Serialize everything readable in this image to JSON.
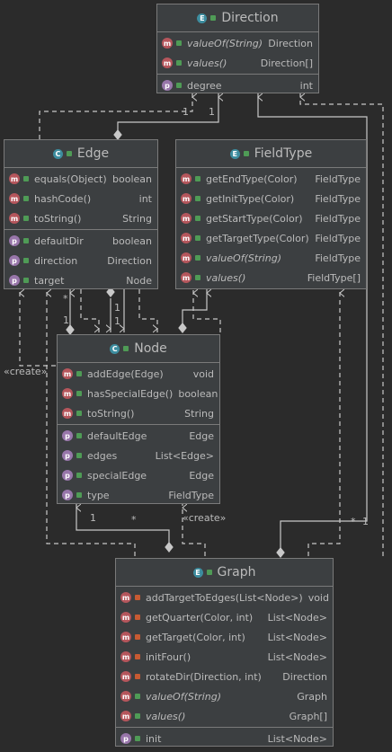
{
  "colors": {
    "background": "#2b2b2b",
    "class_fill": "#3c3f41",
    "class_border": "#7a7a7a",
    "edge_line": "#c8c8c8",
    "enum_badge": "#3d8d9f",
    "class_badge": "#3d8d9f",
    "method_icon": "#b5565c",
    "property_icon": "#9876aa",
    "public_marker": "#4f9b56",
    "private_marker": "#c75a32"
  },
  "classes": {
    "direction": {
      "kind": "E",
      "name": "Direction",
      "sections": [
        [
          {
            "icon": "m",
            "vis": "pub",
            "label": "valueOf(String)",
            "type": "Direction",
            "italic": true
          },
          {
            "icon": "m",
            "vis": "pub",
            "label": "values()",
            "type": "Direction[]",
            "italic": true
          }
        ],
        [
          {
            "icon": "p",
            "vis": "pub",
            "label": "degree",
            "type": "int",
            "italic": false
          }
        ]
      ]
    },
    "edge": {
      "kind": "C",
      "name": "Edge",
      "sections": [
        [
          {
            "icon": "m",
            "vis": "pub",
            "label": "equals(Object)",
            "type": "boolean",
            "italic": false
          },
          {
            "icon": "m",
            "vis": "pub",
            "label": "hashCode()",
            "type": "int",
            "italic": false
          },
          {
            "icon": "m",
            "vis": "pub",
            "label": "toString()",
            "type": "String",
            "italic": false
          }
        ],
        [
          {
            "icon": "p",
            "vis": "pub",
            "label": "defaultDir",
            "type": "boolean",
            "italic": false
          },
          {
            "icon": "p",
            "vis": "pub",
            "label": "direction",
            "type": "Direction",
            "italic": false
          },
          {
            "icon": "p",
            "vis": "pub",
            "label": "target",
            "type": "Node",
            "italic": false
          }
        ]
      ]
    },
    "fieldtype": {
      "kind": "E",
      "name": "FieldType",
      "sections": [
        [
          {
            "icon": "m",
            "vis": "pub",
            "label": "getEndType(Color)",
            "type": "FieldType",
            "italic": false
          },
          {
            "icon": "m",
            "vis": "pub",
            "label": "getInitType(Color)",
            "type": "FieldType",
            "italic": false
          },
          {
            "icon": "m",
            "vis": "pub",
            "label": "getStartType(Color)",
            "type": "FieldType",
            "italic": false
          },
          {
            "icon": "m",
            "vis": "pub",
            "label": "getTargetType(Color)",
            "type": "FieldType",
            "italic": false
          },
          {
            "icon": "m",
            "vis": "pub",
            "label": "valueOf(String)",
            "type": "FieldType",
            "italic": true
          },
          {
            "icon": "m",
            "vis": "pub",
            "label": "values()",
            "type": "FieldType[]",
            "italic": true
          }
        ]
      ]
    },
    "node": {
      "kind": "C",
      "name": "Node",
      "sections": [
        [
          {
            "icon": "m",
            "vis": "pub",
            "label": "addEdge(Edge)",
            "type": "void",
            "italic": false
          },
          {
            "icon": "m",
            "vis": "pub",
            "label": "hasSpecialEdge()",
            "type": "boolean",
            "italic": false
          },
          {
            "icon": "m",
            "vis": "pub",
            "label": "toString()",
            "type": "String",
            "italic": false
          }
        ],
        [
          {
            "icon": "p",
            "vis": "pub",
            "label": "defaultEdge",
            "type": "Edge",
            "italic": false
          },
          {
            "icon": "p",
            "vis": "pub",
            "label": "edges",
            "type": "List<Edge>",
            "italic": false
          },
          {
            "icon": "p",
            "vis": "pub",
            "label": "specialEdge",
            "type": "Edge",
            "italic": false
          },
          {
            "icon": "p",
            "vis": "pub",
            "label": "type",
            "type": "FieldType",
            "italic": false
          }
        ]
      ]
    },
    "graph": {
      "kind": "E",
      "name": "Graph",
      "sections": [
        [
          {
            "icon": "m",
            "vis": "priv",
            "label": "addTargetToEdges(List<Node>)",
            "type": "void",
            "italic": false
          },
          {
            "icon": "m",
            "vis": "priv",
            "label": "getQuarter(Color, int)",
            "type": "List<Node>",
            "italic": false
          },
          {
            "icon": "m",
            "vis": "priv",
            "label": "getTarget(Color, int)",
            "type": "List<Node>",
            "italic": false
          },
          {
            "icon": "m",
            "vis": "priv",
            "label": "initFour()",
            "type": "List<Node>",
            "italic": false
          },
          {
            "icon": "m",
            "vis": "priv",
            "label": "rotateDir(Direction, int)",
            "type": "Direction",
            "italic": false
          },
          {
            "icon": "m",
            "vis": "pub",
            "label": "valueOf(String)",
            "type": "Graph",
            "italic": true
          },
          {
            "icon": "m",
            "vis": "pub",
            "label": "values()",
            "type": "Graph[]",
            "italic": true
          }
        ],
        [
          {
            "icon": "p",
            "vis": "pub",
            "label": "init",
            "type": "List<Node>",
            "italic": false
          }
        ]
      ]
    }
  },
  "edge_labels": {
    "edge_dir_1a": "1",
    "edge_dir_1b": "1",
    "node_edge_star": "*",
    "node_edge_1a": "1",
    "node_edge_1b": "1",
    "node_edge_1c": "1",
    "create_left": "«create»",
    "graph_node_1": "1",
    "graph_node_star": "*",
    "create_graph": "«create»",
    "graph_dir_star": "*",
    "graph_dir_1": "1"
  }
}
